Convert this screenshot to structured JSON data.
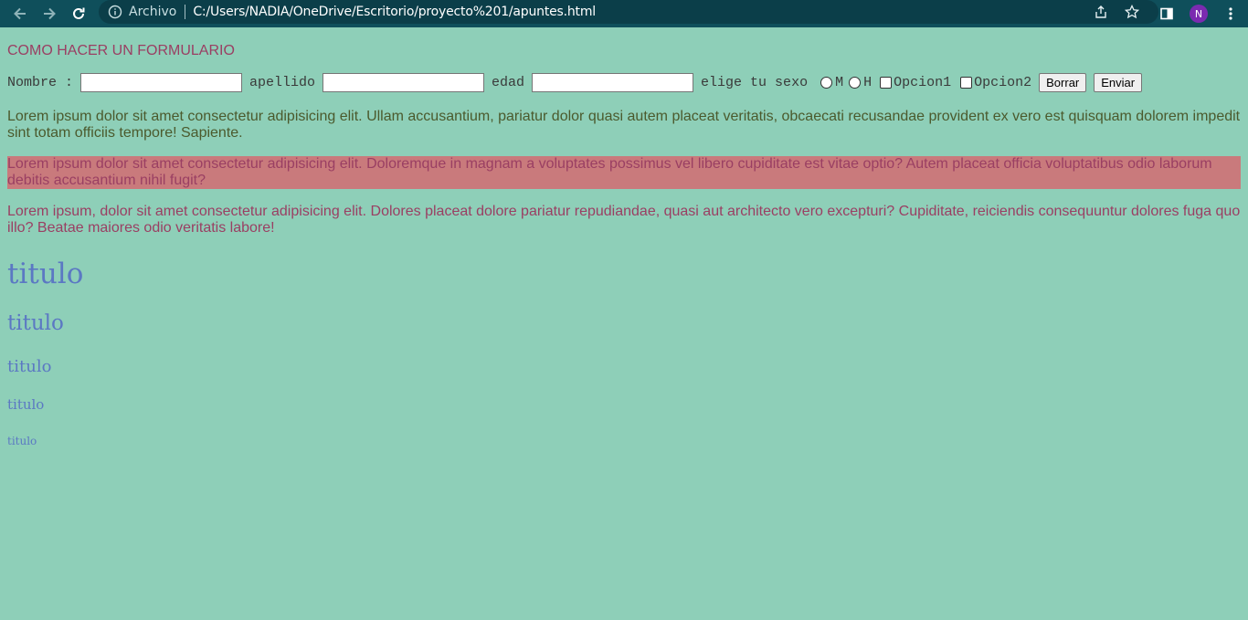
{
  "browser": {
    "omnibox_label": "Archivo",
    "url": "C:/Users/NADIA/OneDrive/Escritorio/proyecto%201/apuntes.html",
    "profile_initial": "N",
    "icons": [
      "back-arrow-icon",
      "forward-arrow-icon",
      "reload-icon",
      "info-icon",
      "share-icon",
      "star-icon",
      "side-panel-icon",
      "kebab-menu-icon"
    ]
  },
  "page": {
    "title": "COMO HACER UN FORMULARIO",
    "form": {
      "nombre_label": "Nombre :",
      "apellido_label": "apellido",
      "edad_label": "edad",
      "sexo_label": "elige tu sexo",
      "radio_m": "M",
      "radio_h": "H",
      "opcion1": "Opcion1",
      "opcion2": "Opcion2",
      "borrar": "Borrar",
      "enviar": "Enviar"
    },
    "paragraphs": [
      "Lorem ipsum dolor sit amet consectetur adipisicing elit. Ullam accusantium, pariatur dolor quasi autem placeat veritatis, obcaecati recusandae provident ex vero est quisquam dolorem impedit sint totam officiis tempore! Sapiente.",
      "Lorem ipsum dolor sit amet consectetur adipisicing elit. Doloremque in magnam a voluptates possimus vel libero cupiditate est vitae optio? Autem placeat officia voluptatibus odio laborum debitis accusantium nihil fugit?",
      "Lorem ipsum, dolor sit amet consectetur adipisicing elit. Dolores placeat dolore pariatur repudiandae, quasi aut architecto vero excepturi? Cupiditate, reiciendis consequuntur dolores fuga quo illo? Beatae maiores odio veritatis labore!"
    ],
    "headings": [
      "titulo",
      "titulo",
      "titulo",
      "titulo",
      "titulo"
    ]
  },
  "colors": {
    "background": "#8ecfb8",
    "chrome": "#0f4f5b",
    "title_text": "#9a3f63",
    "highlight": "#c97a7c",
    "heading_text": "#5b78c3"
  }
}
